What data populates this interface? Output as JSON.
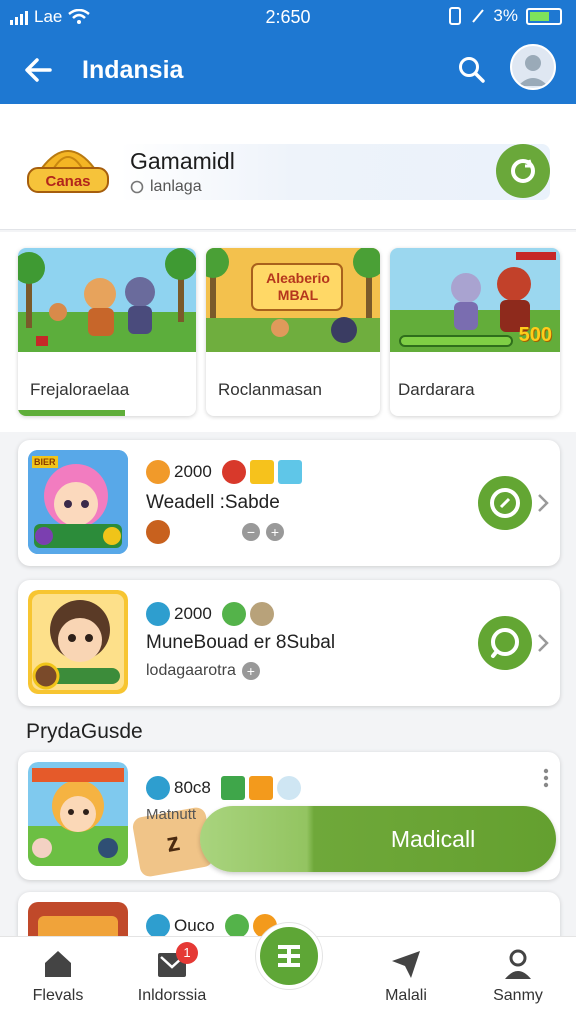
{
  "status_bar": {
    "carrier": "Lae",
    "time": "2:650",
    "battery": "3%"
  },
  "app_bar": {
    "title": "Indansia"
  },
  "header": {
    "title": "Gamamidl",
    "subtitle": "lanlaga",
    "logo_text": "Canas"
  },
  "featured": [
    {
      "label": "Frejaloraelaa",
      "image_text": "",
      "progress": 0.6
    },
    {
      "label": "Roclanmasan",
      "image_text": "Aleaberio MBAL",
      "progress": 0
    },
    {
      "label": "Dardarara",
      "image_text": "500",
      "progress": 0
    }
  ],
  "games": [
    {
      "count": "2000",
      "title": "Weadell :Sabde",
      "subtitle": "",
      "icon_tag": "BIER"
    },
    {
      "count": "2000",
      "title": "MuneBouad er 8Subal",
      "subtitle": "lodagaarotra",
      "icon_tag": ""
    },
    {
      "count": "80c8",
      "title": "Matnutt",
      "subtitle": "",
      "icon_tag": "z"
    },
    {
      "count": "Ouco",
      "title": "",
      "subtitle": "",
      "icon_tag": ""
    }
  ],
  "section_title": "PrydaGusde",
  "install_button": "Madicall",
  "bottom_nav": [
    {
      "label": "Flevals",
      "icon": "home-icon"
    },
    {
      "label": "Inldorssia",
      "icon": "inbox-icon",
      "badge": "1"
    },
    {
      "label": "",
      "icon": "center-menu-icon"
    },
    {
      "label": "Malali",
      "icon": "send-icon"
    },
    {
      "label": "Sanmy",
      "icon": "profile-icon"
    }
  ],
  "colors": {
    "primary": "#1e78d2",
    "accent_green": "#63a633"
  }
}
